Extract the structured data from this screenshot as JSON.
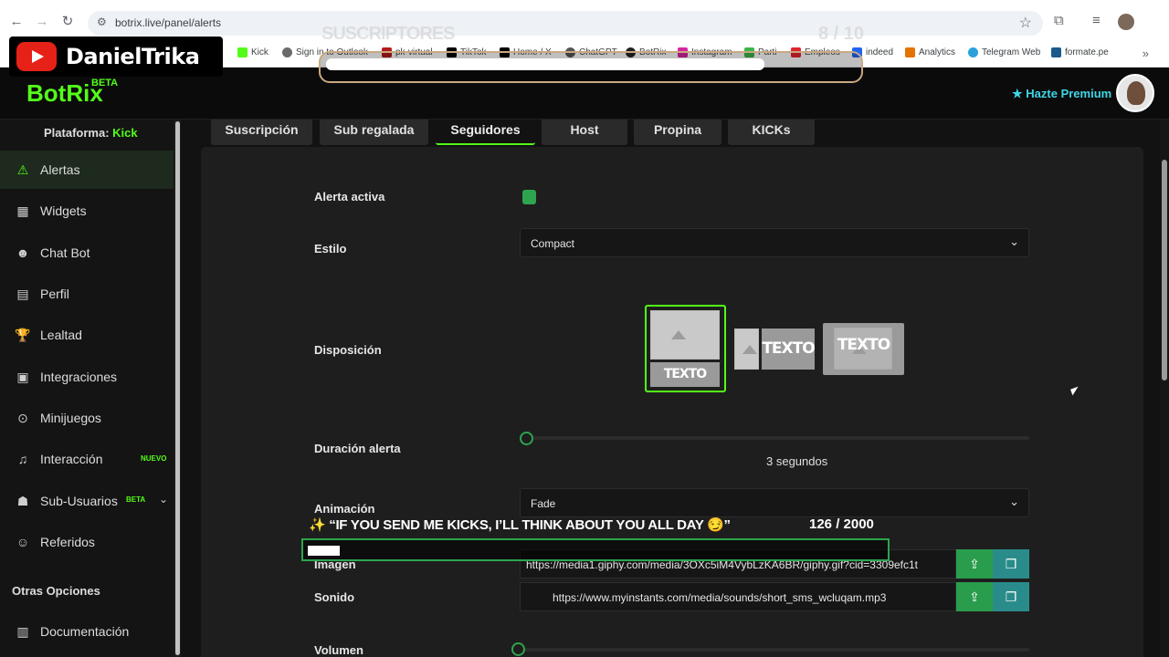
{
  "browser": {
    "url": "botrix.live/panel/alerts",
    "bookmarks": [
      {
        "label": "Kick",
        "color": "#53fc18"
      },
      {
        "label": "Sign in to Outlook",
        "color": "#6b6b6b"
      },
      {
        "label": "pk-virtual",
        "color": "#b31b1b"
      },
      {
        "label": "TikTok",
        "color": "#000000"
      },
      {
        "label": "Home / X",
        "color": "#000000"
      },
      {
        "label": "ChatGPT",
        "color": "#555555"
      },
      {
        "label": "BotRix",
        "color": "#222222"
      },
      {
        "label": "Instagram",
        "color": "#d6249f"
      },
      {
        "label": "Parti",
        "color": "#3ab54a"
      },
      {
        "label": "Empleos",
        "color": "#e4222e"
      },
      {
        "label": "indeed",
        "color": "#2164f3"
      },
      {
        "label": "Analytics",
        "color": "#e37400"
      },
      {
        "label": "Telegram Web",
        "color": "#2aa1da"
      },
      {
        "label": "formate.pe",
        "color": "#1c5a8c"
      }
    ]
  },
  "overlay": {
    "channel_name": "DanielTrika",
    "goal_label": "SUSCRIPTORES",
    "goal_count": "8 / 10",
    "goal_progress": 0.9,
    "kick_message": "✨ “IF YOU SEND ME KICKS, I’LL THINK ABOUT YOU ALL DAY 😏”",
    "kick_count": "126 / 2000",
    "kick_progress": 0.063
  },
  "header": {
    "brand": "BotRix",
    "brand_badge": "BETA",
    "premium_label": "Hazte Premium"
  },
  "sidebar": {
    "platform_label": "Plataforma:",
    "platform_value": "Kick",
    "items": [
      {
        "label": "Alertas",
        "icon": "warning-icon",
        "glyph": "⚠"
      },
      {
        "label": "Widgets",
        "icon": "grid-icon",
        "glyph": "▦"
      },
      {
        "label": "Chat Bot",
        "icon": "robot-icon",
        "glyph": "☻"
      },
      {
        "label": "Perfil",
        "icon": "id-card-icon",
        "glyph": "▤"
      },
      {
        "label": "Lealtad",
        "icon": "trophy-icon",
        "glyph": "🏆"
      },
      {
        "label": "Integraciones",
        "icon": "plug-icon",
        "glyph": "▣"
      },
      {
        "label": "Minijuegos",
        "icon": "gamepad-icon",
        "glyph": "⊙"
      },
      {
        "label": "Interacción",
        "icon": "music-icon",
        "glyph": "♫"
      },
      {
        "label": "Sub-Usuarios",
        "icon": "users-icon",
        "glyph": "☗"
      },
      {
        "label": "Referidos",
        "icon": "user-group-icon",
        "glyph": "☺"
      }
    ],
    "tag_new": "NUEVO",
    "tag_beta": "BETA",
    "section_other": "Otras Opciones",
    "docs_label": "Documentación"
  },
  "tabs": [
    "Suscripción",
    "Sub regalada",
    "Seguidores",
    "Host",
    "Propina",
    "KICKs"
  ],
  "form": {
    "alert_active_label": "Alerta activa",
    "style_label": "Estilo",
    "style_value": "Compact",
    "layout_label": "Disposición",
    "layout_text": "TEXTO",
    "duration_label": "Duración alerta",
    "duration_value": "3 segundos",
    "animation_label": "Animación",
    "animation_value": "Fade",
    "image_label": "Imagen",
    "image_url": "https://media1.giphy.com/media/3OXc5iM4VybLzKA6BR/giphy.gif?cid=3309efc1t",
    "sound_label": "Sonido",
    "sound_url": "https://www.myinstants.com/media/sounds/short_sms_wcluqam.mp3",
    "volume_label": "Volumen"
  },
  "colors": {
    "accent": "#53fc18",
    "premium": "#3fd5e6",
    "upload": "#2a9d4c",
    "gallery": "#2a8c8a"
  }
}
